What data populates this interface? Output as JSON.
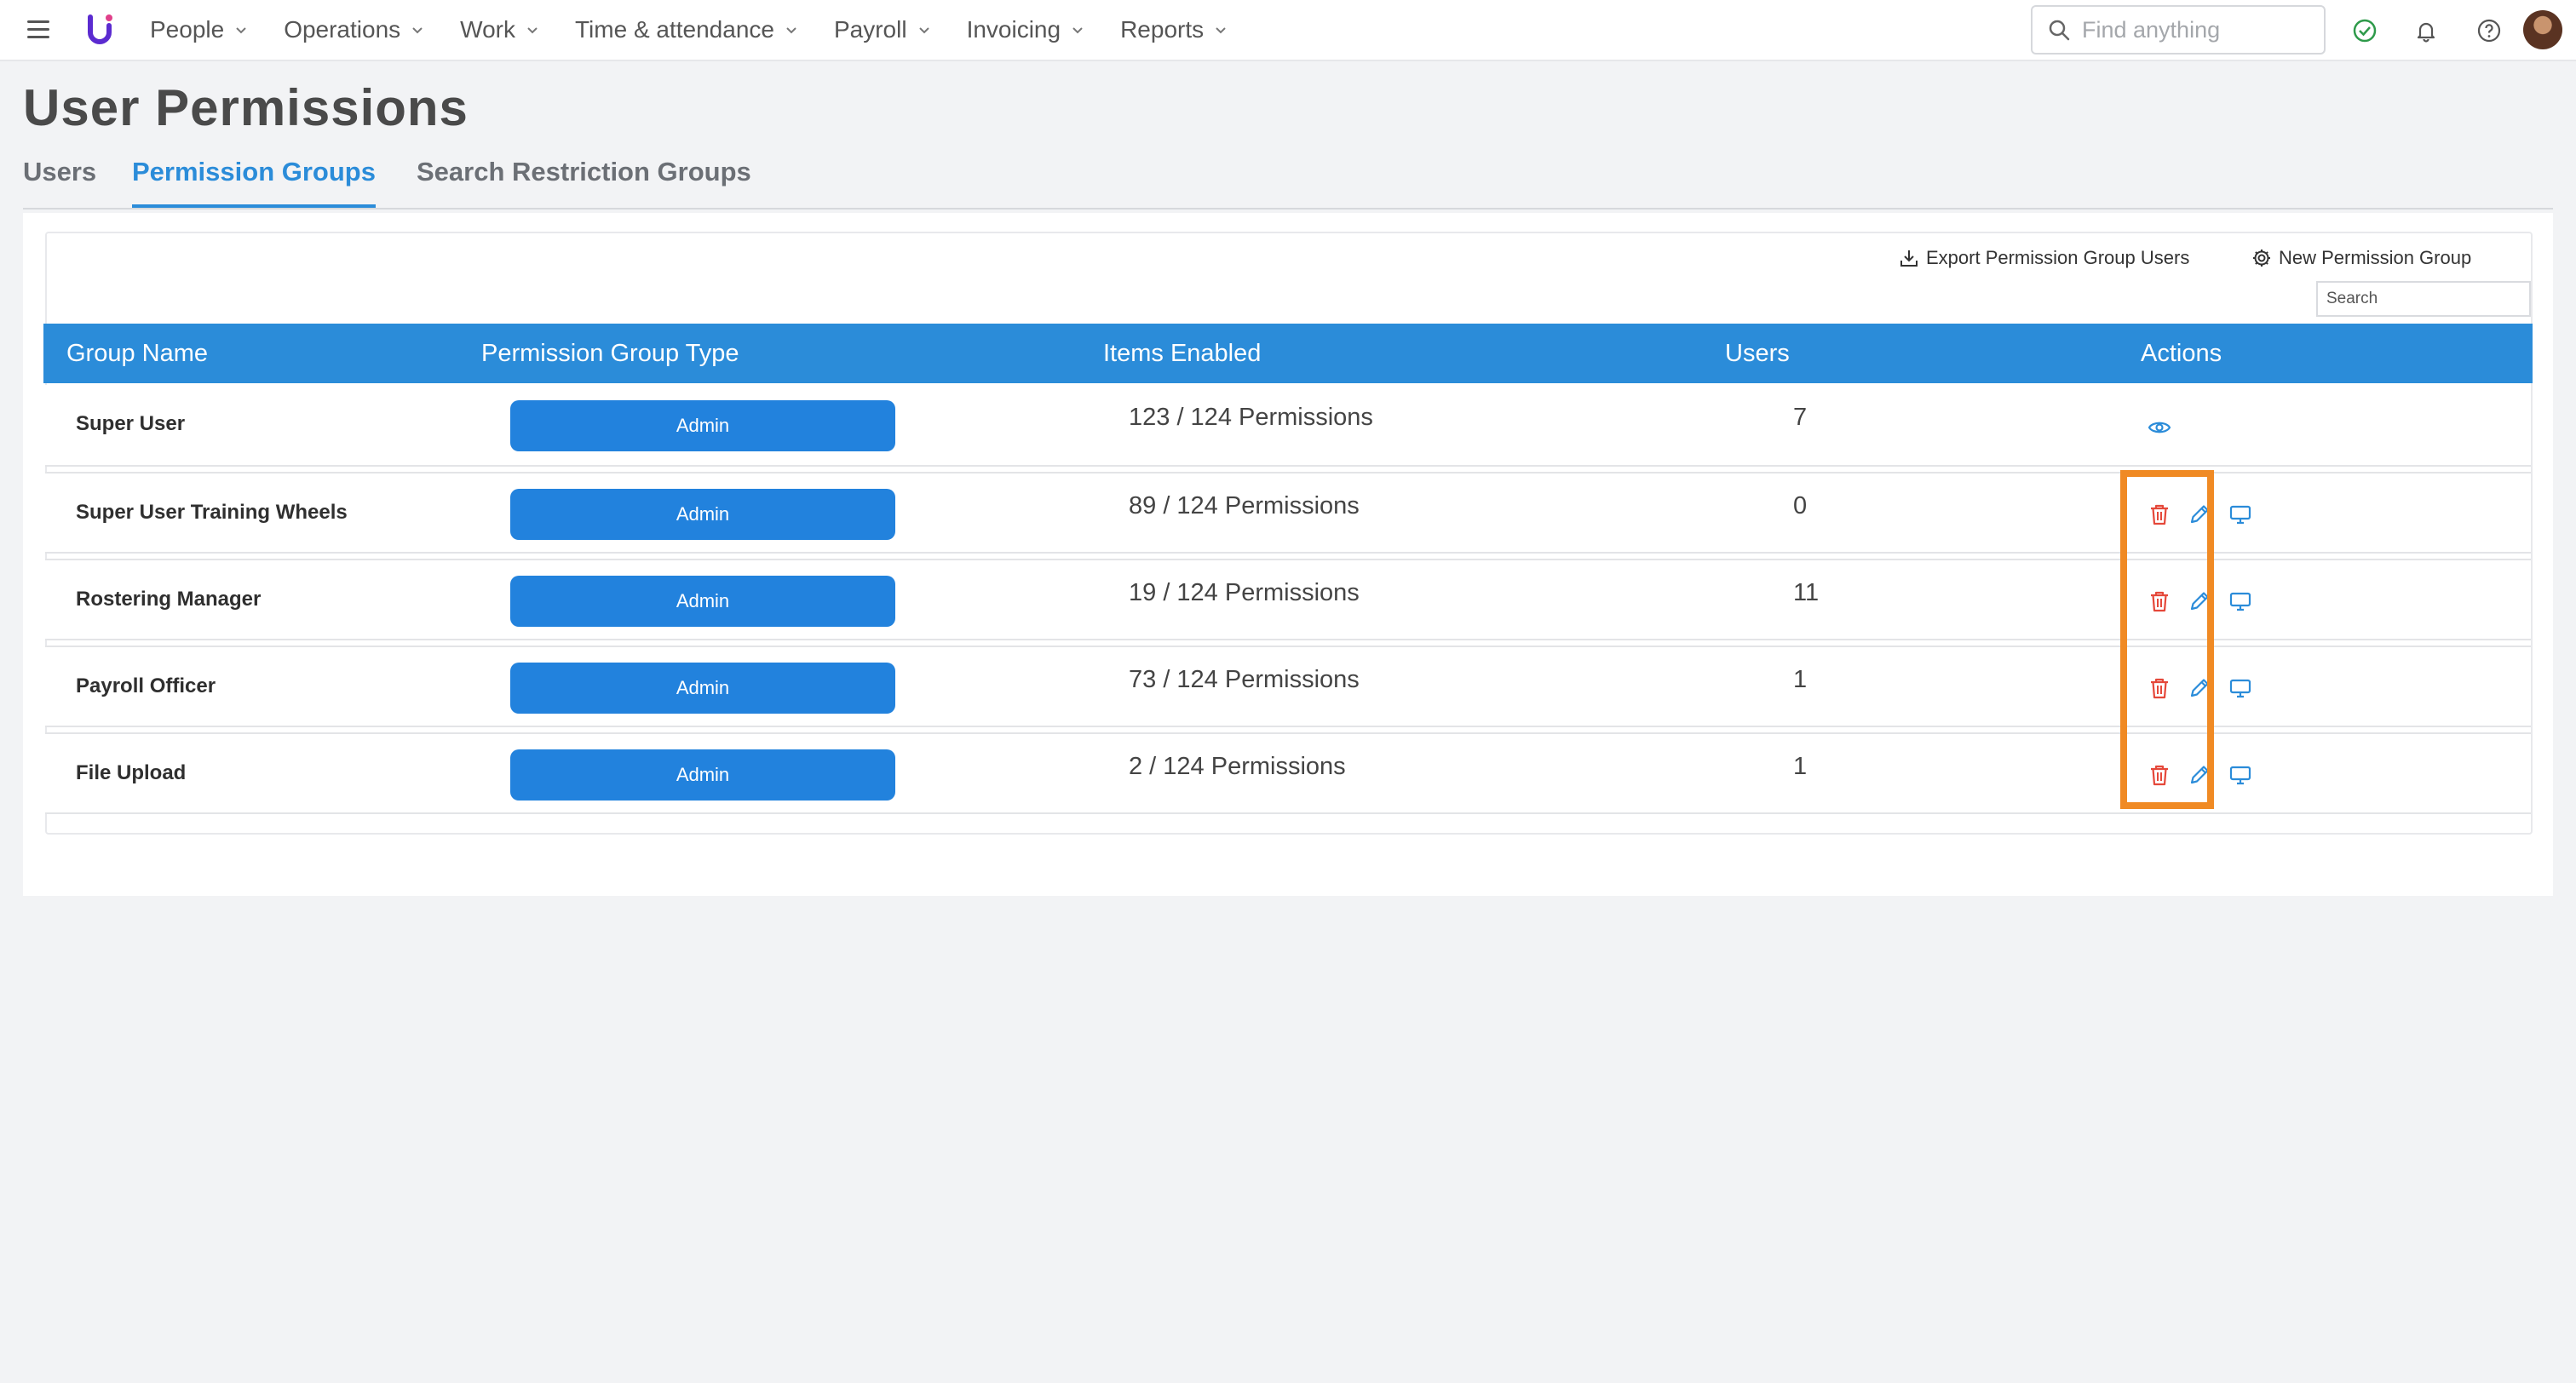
{
  "nav": {
    "items": [
      {
        "label": "People"
      },
      {
        "label": "Operations"
      },
      {
        "label": "Work"
      },
      {
        "label": "Time & attendance"
      },
      {
        "label": "Payroll"
      },
      {
        "label": "Invoicing"
      },
      {
        "label": "Reports"
      }
    ],
    "search_placeholder": "Find anything"
  },
  "page": {
    "title": "User Permissions",
    "tabs": [
      {
        "label": "Users",
        "active": false
      },
      {
        "label": "Permission Groups",
        "active": true
      },
      {
        "label": "Search Restriction Groups",
        "active": false
      }
    ]
  },
  "toolbar": {
    "export_label": "Export Permission Group Users",
    "new_label": "New Permission Group",
    "search_placeholder": "Search"
  },
  "table": {
    "headers": [
      "Group Name",
      "Permission Group Type",
      "Items Enabled",
      "Users",
      "Actions"
    ],
    "rows": [
      {
        "name": "Super User",
        "type": "Admin",
        "items": "123 / 124 Permissions",
        "users": "7",
        "actions": [
          "view"
        ]
      },
      {
        "name": "Super User Training Wheels",
        "type": "Admin",
        "items": "89 / 124 Permissions",
        "users": "0",
        "actions": [
          "delete",
          "edit",
          "desktop"
        ]
      },
      {
        "name": "Rostering Manager",
        "type": "Admin",
        "items": "19 / 124 Permissions",
        "users": "11",
        "actions": [
          "delete",
          "edit",
          "desktop"
        ]
      },
      {
        "name": "Payroll Officer",
        "type": "Admin",
        "items": "73 / 124 Permissions",
        "users": "1",
        "actions": [
          "delete",
          "edit",
          "desktop"
        ]
      },
      {
        "name": "File Upload",
        "type": "Admin",
        "items": "2 / 124 Permissions",
        "users": "1",
        "actions": [
          "delete",
          "edit",
          "desktop"
        ]
      }
    ]
  },
  "colors": {
    "accent": "#2b8cd9",
    "badge": "#2282dd",
    "delete": "#e5483a",
    "highlight": "#f08a24",
    "status_ok": "#2e9a4a"
  },
  "icons": [
    "menu-icon",
    "logo-icon",
    "search-icon",
    "check-circle-icon",
    "bell-icon",
    "help-icon",
    "download-icon",
    "gear-icon",
    "eye-icon",
    "trash-icon",
    "pencil-icon",
    "desktop-icon"
  ]
}
